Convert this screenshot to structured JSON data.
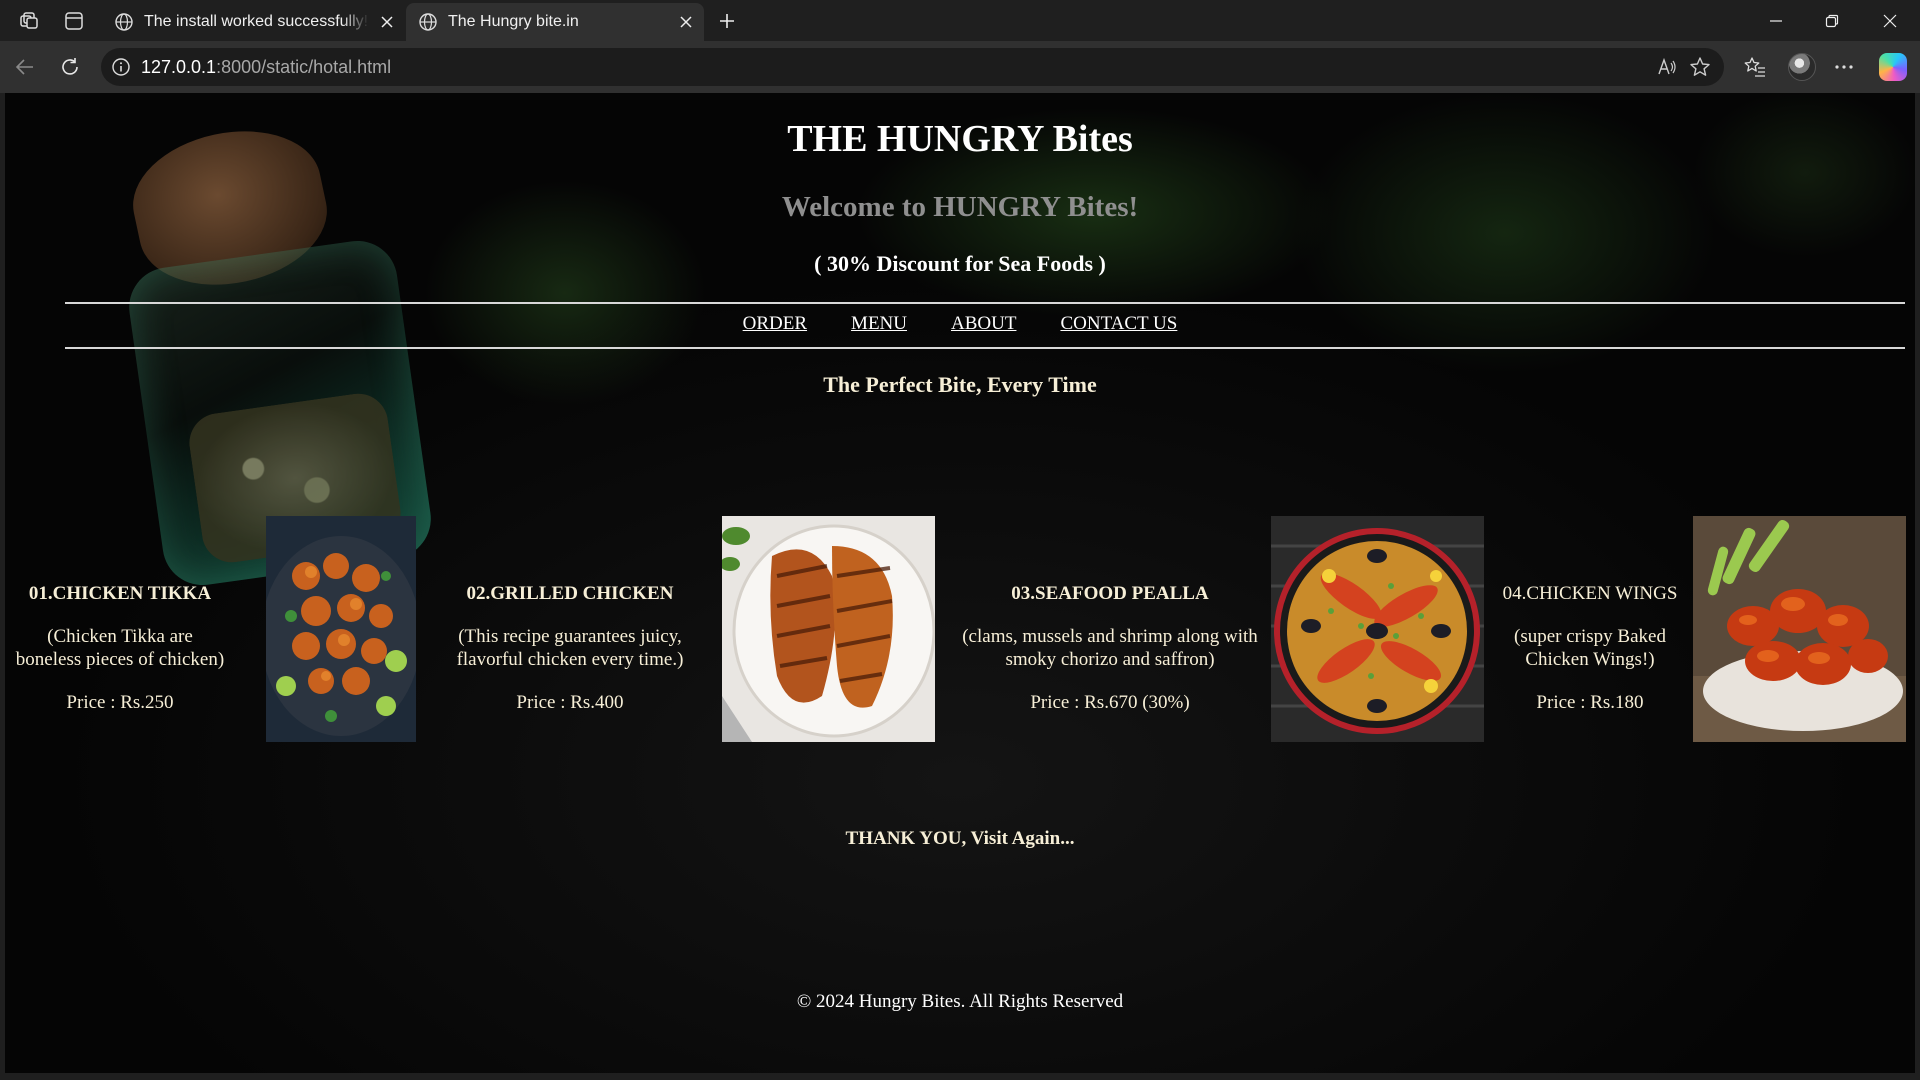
{
  "browser": {
    "tabs": [
      {
        "title": "The install worked successfully! Congratulations!",
        "active": false
      },
      {
        "title": "The Hungry bite.in",
        "active": true
      }
    ],
    "url_host": "127.0.0.1",
    "url_path": ":8000/static/hotal.html"
  },
  "page": {
    "title": "THE HUNGRY Bites",
    "welcome": "Welcome to HUNGRY Bites!",
    "discount": "( 30% Discount for Sea Foods )",
    "nav": [
      "ORDER",
      "MENU",
      "ABOUT",
      "CONTACT US"
    ],
    "tagline": "The Perfect Bite, Every Time",
    "items": [
      {
        "name": "01.CHICKEN TIKKA",
        "description": "(Chicken Tikka are boneless pieces of chicken)",
        "price": "Price : Rs.250"
      },
      {
        "name": "02.GRILLED CHICKEN",
        "description": "(This recipe guarantees juicy, flavorful chicken every time.)",
        "price": "Price : Rs.400"
      },
      {
        "name": "03.SEAFOOD PEALLA",
        "description": "(clams, mussels and shrimp along with smoky chorizo and saffron)",
        "price": "Price : Rs.670 (30%)"
      },
      {
        "name": "04.CHICKEN WINGS",
        "description": "(super crispy Baked Chicken Wings!)",
        "price": "Price : Rs.180"
      }
    ],
    "thanks": "THANK YOU, Visit Again...",
    "footer": "© 2024 Hungry Bites. All Rights Reserved"
  },
  "colors": {
    "chrome_bg": "#1f1f1f",
    "toolbar_bg": "#303030",
    "item_text": "#f7efd7",
    "welcome_text": "#8f8f8f"
  }
}
